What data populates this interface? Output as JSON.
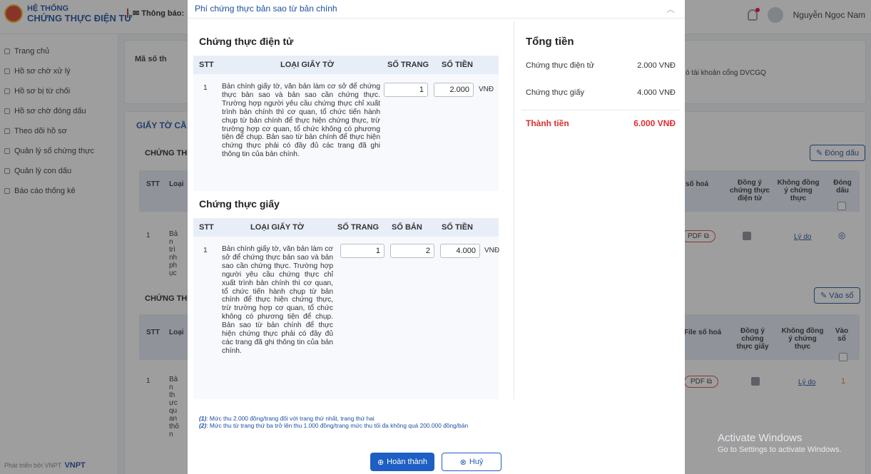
{
  "app": {
    "logo_line1": "HỆ THỐNG",
    "logo_line2": "CHỨNG THỰC ĐIỆN TỬ",
    "notice_label": "Thông báo:",
    "user_name": "Nguyễn Ngọc Nam"
  },
  "sidebar": {
    "items": [
      {
        "label": "Trang chủ"
      },
      {
        "label": "Hồ sơ chờ xử lý"
      },
      {
        "label": "Hồ sơ bị từ chối"
      },
      {
        "label": "Hồ sơ chờ đóng dấu"
      },
      {
        "label": "Theo dõi hồ sơ"
      },
      {
        "label": "Quản lý sổ chứng thực"
      },
      {
        "label": "Quản lý con dấu"
      },
      {
        "label": "Báo cáo thống kê"
      }
    ],
    "footer": "Phát triển bởi VNPT",
    "footer_brand": "VNPT"
  },
  "background": {
    "ma_so_label": "Mã số th",
    "account_text": "ó tài khoản cổng DVCGQ",
    "section_title": "GIẤY TỜ CẦ",
    "sub1": "CHỨNG THỰ",
    "sub2": "CHỨNG THỰ",
    "dong_dau_button": "Đóng dấu",
    "vao_so_button": "Vào sổ",
    "col_stt": "STT",
    "col_loai": "Loại",
    "col_so_hoa": "số hoá",
    "col_file_so_hoa": "File số hoá",
    "col_dong_y_dt": "Đồng ý chứng thực điện tử",
    "col_dong_y_giay": "Đồng ý chứng thực giấy",
    "col_khong_dong_y": "Không đồng ý chứng thực",
    "col_dong_dau": "Đóng dấu",
    "col_vao_so": "Vào sổ",
    "row_index": "1",
    "pdf_label": "PDF",
    "ly_do": "Lý do",
    "vao_so_value": "1",
    "row1_frag": "Bản trình phục",
    "row2_frag": "Bản thực quan thôn"
  },
  "watermark": {
    "line1": "Activate Windows",
    "line2": "Go to Settings to activate Windows."
  },
  "modal": {
    "title": "Phí chứng thực bản sao từ bản chính",
    "close_icon": "chevron-up-icon",
    "electronic": {
      "title": "Chứng thực điện tử",
      "headers": [
        "STT",
        "LOẠI GIẤY TỜ",
        "SỐ TRANG",
        "SỐ TIỀN"
      ],
      "row": {
        "stt": "1",
        "description": "Bản chính giấy tờ, văn bản làm cơ sở để chứng thực bản sao và bản sao cần chứng thực. Trường hợp người yêu cầu chứng thực chỉ xuất trình bản chính thì cơ quan, tổ chức tiến hành chụp từ bản chính để thực hiện chứng thực, trừ trường hợp cơ quan, tổ chức không có phương tiện để chụp. Bản sao từ bản chính để thực hiện chứng thực phải có đầy đủ các trang đã ghi thông tin của bản chính.",
        "so_trang": "1",
        "so_tien": "2.000",
        "unit": "VNĐ"
      }
    },
    "paper": {
      "title": "Chứng thực giấy",
      "headers": [
        "STT",
        "LOẠI GIẤY TỜ",
        "SỐ TRANG",
        "SỐ BẢN",
        "SỐ TIỀN"
      ],
      "row": {
        "stt": "1",
        "description": "Bản chính giấy tờ, văn bản làm cơ sở để chứng thực bản sao và bản sao cần chứng thực. Trường hợp người yêu cầu chứng thực chỉ xuất trình bản chính thì cơ quan, tổ chức tiến hành chụp từ bản chính để thực hiện chứng thực, trừ trường hợp cơ quan, tổ chức không có phương tiện để chụp. Bản sao từ bản chính để thực hiện chứng thực phải có đầy đủ các trang đã ghi thông tin của bản chính.",
        "so_trang": "1",
        "so_ban": "2",
        "so_tien": "4.000",
        "unit": "VNĐ"
      }
    },
    "notes": {
      "n1_tag": "(1)",
      "n1": ": Mức thu 2.000 đồng/trang đối với trang thứ nhất, trang thứ hai",
      "n2_tag": "(2)",
      "n2": ": Mức thu từ trang thứ ba trở lên thu 1.000 đồng/trang mức thu tối đa không quá 200.000 đồng/bản"
    },
    "total": {
      "title": "Tổng tiền",
      "electronic_label": "Chứng thực điện tử",
      "electronic_value": "2.000 VNĐ",
      "paper_label": "Chứng thực giấy",
      "paper_value": "4.000 VNĐ",
      "final_label": "Thành tiền",
      "final_value": "6.000 VNĐ"
    },
    "buttons": {
      "ok": "Hoàn thành",
      "cancel": "Huỷ"
    }
  },
  "colors": {
    "primary": "#1d5fc2",
    "title_blue": "#1d4fa0",
    "total_red": "#d9302c",
    "header_band": "#e8eef8"
  }
}
